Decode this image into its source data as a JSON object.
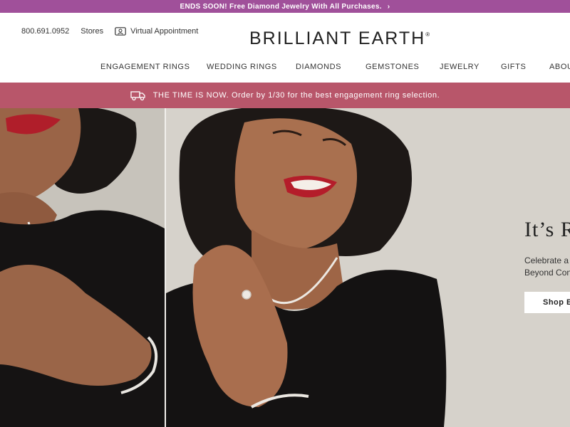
{
  "promo": {
    "text": "ENDS SOON! Free Diamond Jewelry With All Purchases.",
    "chevron": "›"
  },
  "header": {
    "phone": "800.691.0952",
    "stores": "Stores",
    "virtual": "Virtual Appointment",
    "logo": "BRILLIANT EARTH",
    "logo_mark": "®"
  },
  "nav": {
    "items": [
      "ENGAGEMENT RINGS",
      "WEDDING RINGS",
      "DIAMONDS",
      "GEMSTONES",
      "JEWELRY",
      "GIFTS",
      "ABOUT"
    ]
  },
  "notice": {
    "text": "THE TIME IS NOW. Order by 1/30 for the best engagement ring selection."
  },
  "hero": {
    "title": "It’s R",
    "sub_line1": "Celebrate a",
    "sub_line2": "Beyond Con",
    "button": "Shop E"
  },
  "colors": {
    "promo_bg": "#a0509a",
    "notice_bg": "#b8566a"
  },
  "icons": {
    "virtual": "video-chat-icon",
    "notice": "delivery-truck-icon"
  }
}
